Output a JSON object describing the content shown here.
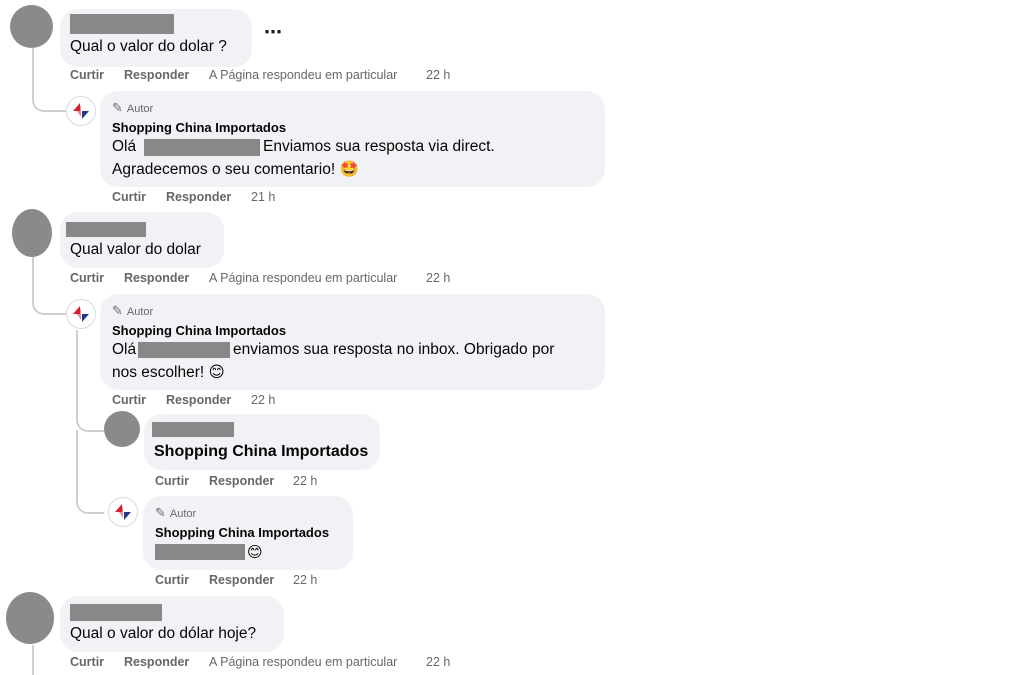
{
  "comments": [
    {
      "text": "Qual o valor do dolar ?",
      "more_icon": "⋯",
      "actions": {
        "like": "Curtir",
        "reply": "Responder",
        "status": "A Página respondeu em particular",
        "time": "22 h"
      },
      "reply": {
        "author_badge": "Autor",
        "name": "Shopping China Importados",
        "text_a": "Olá",
        "text_b": "Enviamos sua resposta via direct.",
        "text_c": "Agradecemos o seu comentario! 🤩",
        "actions": {
          "like": "Curtir",
          "reply": "Responder",
          "time": "21 h"
        }
      }
    },
    {
      "text": "Qual valor do dolar",
      "actions": {
        "like": "Curtir",
        "reply": "Responder",
        "status": "A Página respondeu em particular",
        "time": "22 h"
      },
      "reply": {
        "author_badge": "Autor",
        "name": "Shopping China Importados",
        "text_a": "Olá",
        "text_b": "enviamos sua resposta no inbox. Obrigado por",
        "text_c": "nos escolher! 😊",
        "actions": {
          "like": "Curtir",
          "reply": "Responder",
          "time": "22 h"
        }
      },
      "user_reply": {
        "text": "Shopping China Importados",
        "actions": {
          "like": "Curtir",
          "reply": "Responder",
          "time": "22 h"
        }
      },
      "page_reply": {
        "author_badge": "Autor",
        "name": "Shopping China Importados",
        "emoji": "😊",
        "actions": {
          "like": "Curtir",
          "reply": "Responder",
          "time": "22 h"
        }
      }
    },
    {
      "text": "Qual o valor do dólar hoje?",
      "actions": {
        "like": "Curtir",
        "reply": "Responder",
        "status": "A Página respondeu em particular",
        "time": "22 h"
      }
    }
  ],
  "colors": {
    "bubble": "#f0f2f5",
    "meta_text": "#65676b",
    "redaction": "#888888",
    "page_logo_red": "#d4202c",
    "page_logo_blue": "#1f3a8a"
  }
}
